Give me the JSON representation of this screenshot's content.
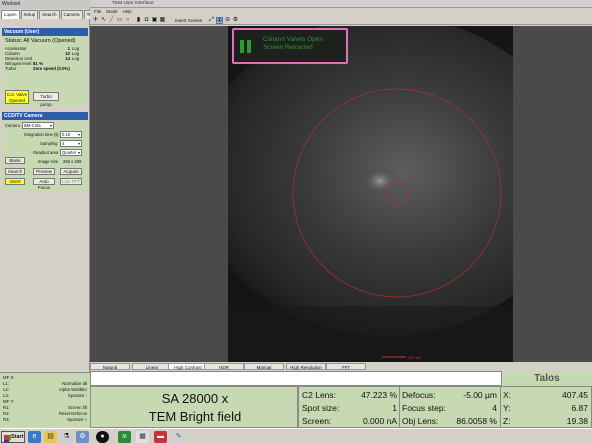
{
  "left_window": {
    "title": "Workset",
    "tabs": [
      "Lopen",
      "Setup",
      "Search",
      "Camera",
      "TL"
    ],
    "vacuum": {
      "header": "Vacuum (User)",
      "status": "Status: All Vacuum (Opened)",
      "rows": [
        {
          "name": "Accelerator",
          "value": "1",
          "unit": "Log"
        },
        {
          "name": "Column",
          "value": "10",
          "unit": "Log"
        },
        {
          "name": "Detection Unit",
          "value": "14",
          "unit": "Log"
        },
        {
          "name": "Nitrogen level",
          "value": "81 %",
          "unit": ""
        },
        {
          "name": "Turbo",
          "value": "Zero speed (0.0%)",
          "unit": ""
        }
      ],
      "col_valve_label": "Col. Valve Opened",
      "turbo_pump_label": "Turbo pump"
    },
    "camera": {
      "header": "CCD/TV Camera",
      "camera_label": "Camera",
      "camera_value": "BM-Ceta",
      "integration_label": "Integration time [s]",
      "integration_value": "0.15",
      "sampling_label": "Sampling",
      "sampling_value": "4",
      "readout_label": "Readout area",
      "readout_value": "Quarter",
      "blank_label": "Blank",
      "image_size_label": "Image size",
      "image_size_value": "256 x 256",
      "search_label": "Search",
      "preview_label": "Preview",
      "acquire_label": "Acquire",
      "insert_label": "Insert",
      "autofocus_label": "Auto Focus",
      "live_fft_label": "Live FFT"
    },
    "function_keys": [
      {
        "key": "MF X:",
        "fn": ""
      },
      {
        "key": "L1:",
        "fn": "Normalize all"
      },
      {
        "key": "L2:",
        "fn": "Alpha Wobbler"
      },
      {
        "key": "L3:",
        "fn": "Spotsize -"
      },
      {
        "key": "MF Y:",
        "fn": ""
      },
      {
        "key": "R1:",
        "fn": "Screen lift"
      },
      {
        "key": "R2:",
        "fn": "Reset Defocus"
      },
      {
        "key": "R3:",
        "fn": "Spotsize +"
      }
    ]
  },
  "main_window": {
    "title": "TEM User Interface",
    "menu": [
      "File",
      "Mode",
      "Help"
    ],
    "insert_screen_label": "Insert Screen",
    "notice_line1": "Column Valves Open",
    "notice_line2": "Screen Retracted",
    "scale_label": "200 nm",
    "filters": [
      "Natural",
      "Linear",
      "High Contrast",
      "HDR",
      "Manual",
      "High Resolution",
      "FFT"
    ],
    "active_filter": "High Contrast",
    "brand": "Talos",
    "magnification": "SA 28000 x",
    "mode": "TEM Bright field",
    "readouts": {
      "c2_lens_label": "C2 Lens:",
      "c2_lens_value": "47.223 %",
      "spot_size_label": "Spot size:",
      "spot_size_value": "1",
      "screen_label": "Screen:",
      "screen_value": "0.000 nA",
      "defocus_label": "Defocus:",
      "defocus_value": "-5.00 µm",
      "focus_step_label": "Focus step:",
      "focus_step_value": "4",
      "obj_lens_label": "Obj Lens:",
      "obj_lens_value": "86.0058 %",
      "x_label": "X:",
      "x_value": "407.45",
      "y_label": "Y:",
      "y_value": "6.87",
      "z_label": "Z:",
      "z_value": "19.38"
    }
  },
  "taskbar": {
    "start_label": "Start"
  }
}
